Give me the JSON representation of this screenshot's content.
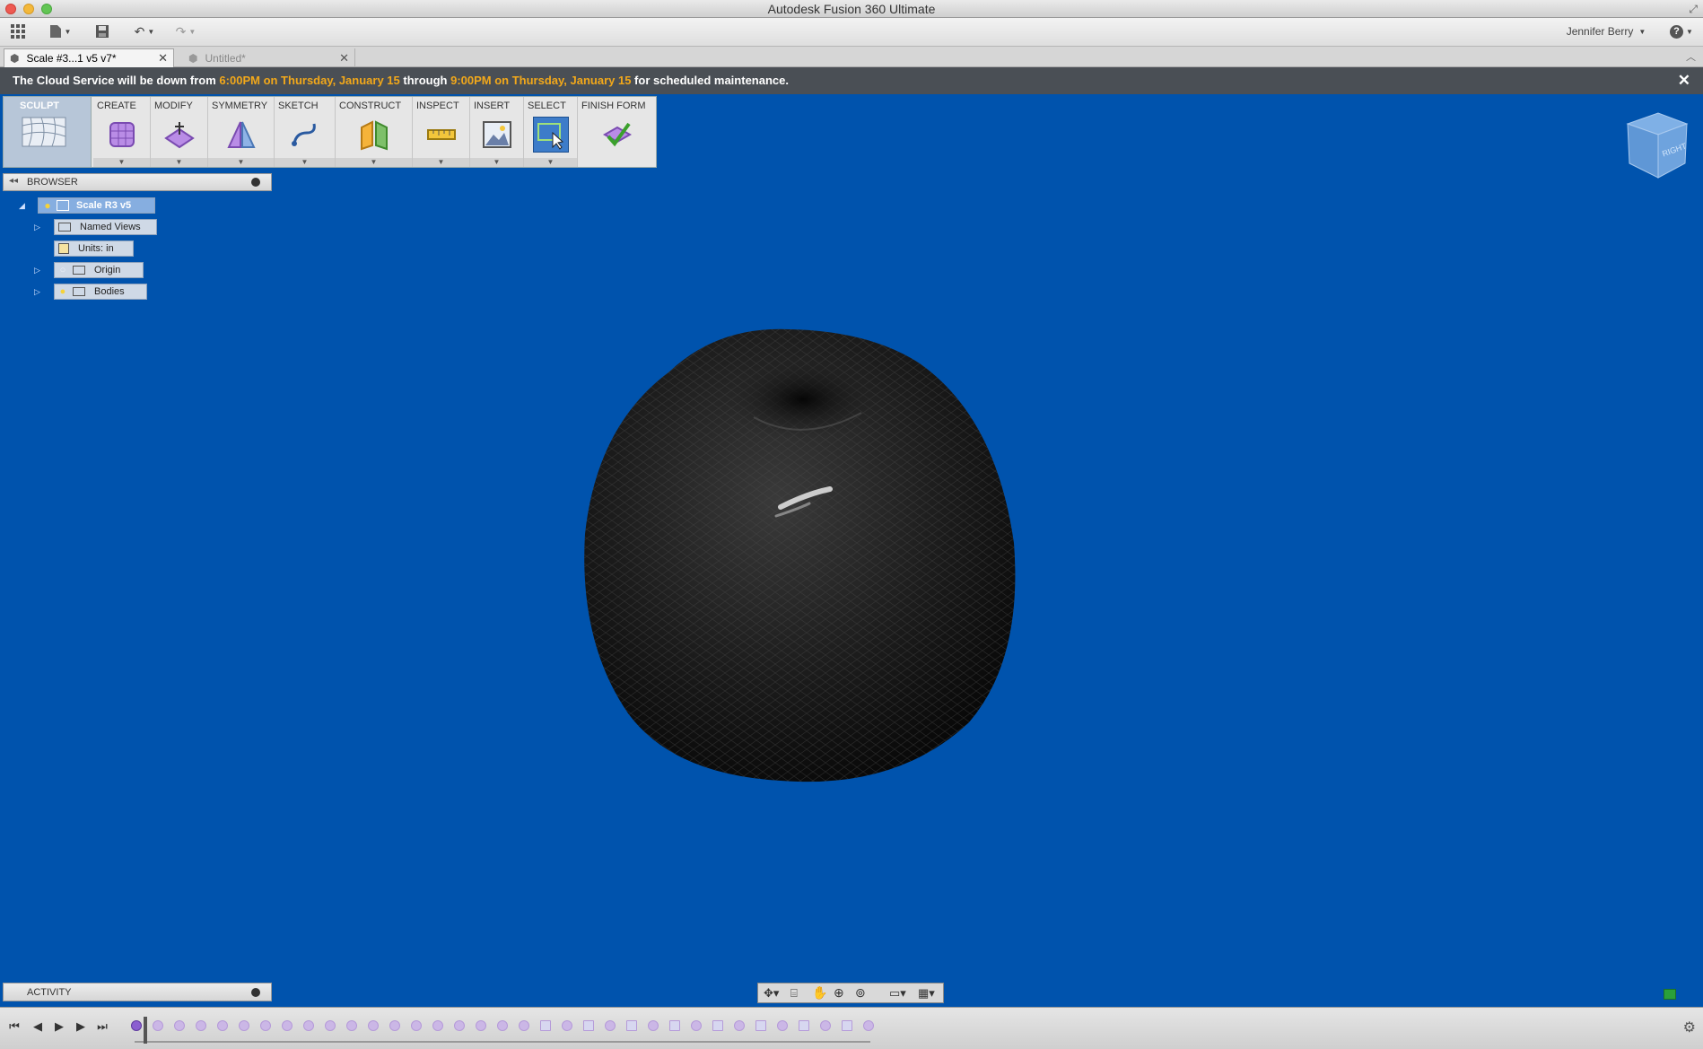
{
  "window": {
    "title": "Autodesk Fusion 360 Ultimate"
  },
  "toolbar": {
    "user_name": "Jennifer Berry",
    "help_label": "?"
  },
  "tabs": [
    {
      "label": "Scale #3...1 v5 v7*"
    },
    {
      "label": "Untitled*"
    }
  ],
  "banner": {
    "text_1": "The Cloud Service will be down from ",
    "start_time": "6:00PM",
    "start_date": " on Thursday, January 15",
    "text_2": " through ",
    "end_time": "9:00PM",
    "end_date": " on Thursday, January 15",
    "text_3": " for scheduled maintenance."
  },
  "ribbon": {
    "workspace": "SCULPT",
    "groups": [
      "CREATE",
      "MODIFY",
      "SYMMETRY",
      "SKETCH",
      "CONSTRUCT",
      "INSPECT",
      "INSERT",
      "SELECT",
      "FINISH FORM"
    ]
  },
  "browser": {
    "title": "BROWSER",
    "root": "Scale R3 v5",
    "items": [
      "Named Views",
      "Units: in",
      "Origin",
      "Bodies"
    ]
  },
  "viewcube": {
    "face_label": "RIGHT"
  },
  "activity": {
    "title": "ACTIVITY"
  },
  "colors": {
    "viewport": "#0053ad",
    "banner_highlight": "#f2a81a",
    "banner_bg": "#4a4f55"
  }
}
